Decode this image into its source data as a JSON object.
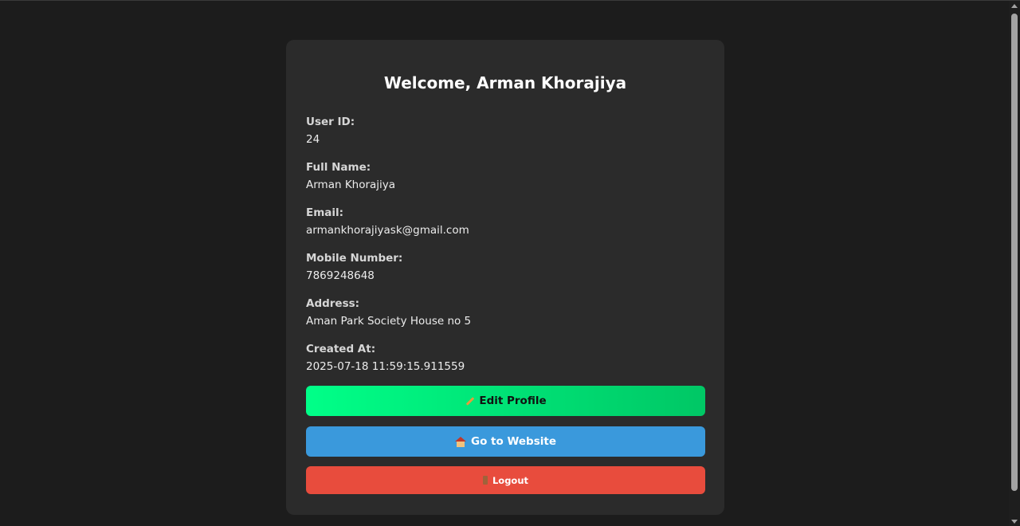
{
  "profile": {
    "title": "Welcome, Arman Khorajiya",
    "fields": [
      {
        "label": "User ID:",
        "value": "24"
      },
      {
        "label": "Full Name:",
        "value": "Arman Khorajiya"
      },
      {
        "label": "Email:",
        "value": "armankhorajiyask@gmail.com"
      },
      {
        "label": "Mobile Number:",
        "value": "7869248648"
      },
      {
        "label": "Address:",
        "value": "Aman Park Society House no 5"
      },
      {
        "label": "Created At:",
        "value": "2025-07-18 11:59:15.911559"
      }
    ]
  },
  "actions": {
    "edit_label": "Edit Profile",
    "edit_icon": "pencil-icon",
    "website_label": "Go to Website",
    "website_icon": "house-icon",
    "logout_label": "Logout",
    "logout_icon": "door-icon"
  },
  "colors": {
    "page_bg": "#1c1c1c",
    "card_bg": "#2b2b2b",
    "edit_start": "#00ff88",
    "edit_end": "#00c765",
    "website": "#3a99dc",
    "logout": "#e84c3d"
  }
}
